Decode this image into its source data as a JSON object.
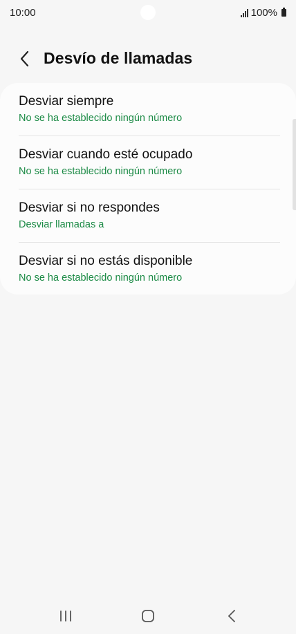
{
  "status_bar": {
    "time": "10:00",
    "battery": "100%",
    "icons": [
      "signal-icon",
      "battery-icon"
    ]
  },
  "header": {
    "back_icon": "chevron-left-icon",
    "title": "Desvío de llamadas"
  },
  "list": {
    "items": [
      {
        "title": "Desviar siempre",
        "subtitle": "No se ha establecido ningún número"
      },
      {
        "title": "Desviar cuando esté ocupado",
        "subtitle": "No se ha establecido ningún número"
      },
      {
        "title": "Desviar si no respondes",
        "subtitle": "Desviar llamadas a"
      },
      {
        "title": "Desviar si no estás disponible",
        "subtitle": "No se ha establecido ningún número"
      }
    ]
  },
  "nav_bar": {
    "icons": [
      "recent-apps-icon",
      "home-icon",
      "back-icon"
    ]
  },
  "colors": {
    "background": "#f6f6f6",
    "card": "#fcfcfc",
    "accent_green": "#1b8a45",
    "text": "#111111"
  }
}
